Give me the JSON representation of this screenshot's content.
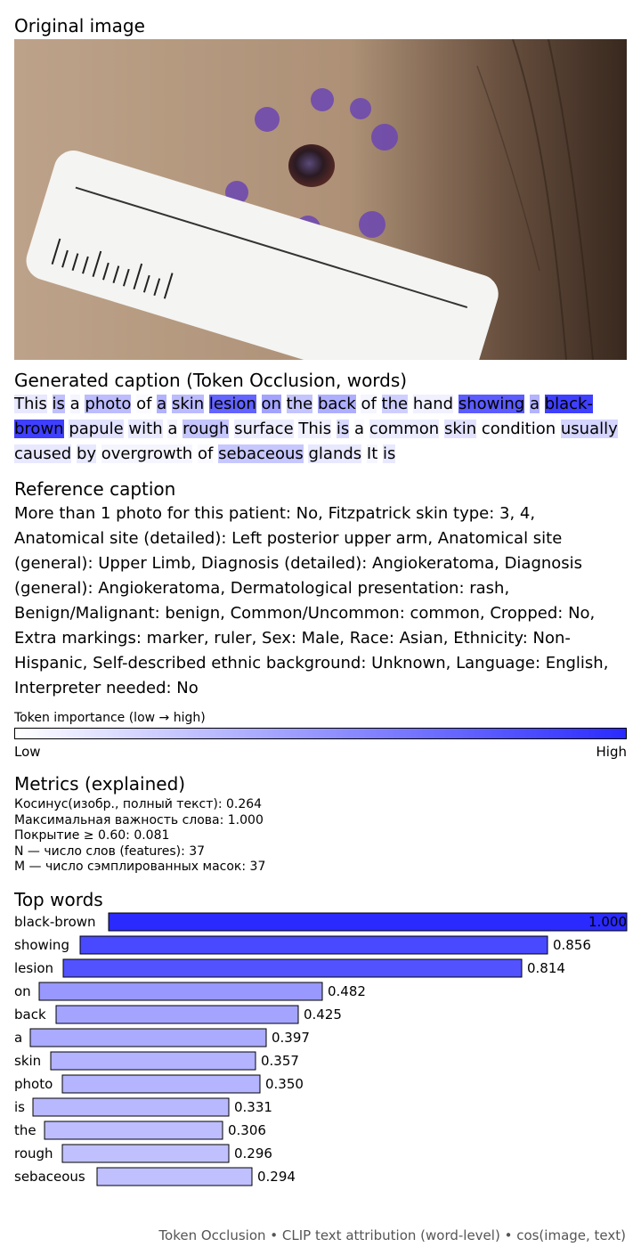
{
  "headings": {
    "original": "Original image",
    "generated": "Generated caption (Token Occlusion, words)",
    "reference": "Reference caption",
    "metrics": "Metrics (explained)",
    "top_words": "Top words"
  },
  "caption_words": [
    {
      "w": "This",
      "s": 0.12
    },
    {
      "w": "is",
      "s": 0.33
    },
    {
      "w": "a",
      "s": 0.05
    },
    {
      "w": "photo",
      "s": 0.35
    },
    {
      "w": "of",
      "s": 0.02
    },
    {
      "w": "a",
      "s": 0.4
    },
    {
      "w": "skin",
      "s": 0.357
    },
    {
      "w": "lesion",
      "s": 0.814
    },
    {
      "w": "on",
      "s": 0.482
    },
    {
      "w": "the",
      "s": 0.306
    },
    {
      "w": "back",
      "s": 0.425
    },
    {
      "w": "of",
      "s": 0.05
    },
    {
      "w": "the",
      "s": 0.25
    },
    {
      "w": "hand",
      "s": 0.08
    },
    {
      "w": "showing",
      "s": 0.856
    },
    {
      "w": "a",
      "s": 0.397
    },
    {
      "w": "black-brown",
      "s": 1.0
    },
    {
      "w": "papule",
      "s": 0.15
    },
    {
      "w": "with",
      "s": 0.12
    },
    {
      "w": "a",
      "s": 0.05
    },
    {
      "w": "rough",
      "s": 0.296
    },
    {
      "w": "surface",
      "s": 0.1
    },
    {
      "w": "This",
      "s": 0.08
    },
    {
      "w": "is",
      "s": 0.2
    },
    {
      "w": "a",
      "s": 0.03
    },
    {
      "w": "common",
      "s": 0.1
    },
    {
      "w": "skin",
      "s": 0.15
    },
    {
      "w": "condition",
      "s": 0.03
    },
    {
      "w": "usually",
      "s": 0.22
    },
    {
      "w": "caused",
      "s": 0.12
    },
    {
      "w": "by",
      "s": 0.12
    },
    {
      "w": "overgrowth",
      "s": 0.05
    },
    {
      "w": "of",
      "s": 0.03
    },
    {
      "w": "sebaceous",
      "s": 0.294
    },
    {
      "w": "glands",
      "s": 0.12
    },
    {
      "w": "It",
      "s": 0.05
    },
    {
      "w": "is",
      "s": 0.12
    }
  ],
  "reference_caption": "More than 1 photo for this patient: No, Fitzpatrick skin type: 3, 4, Anatomical site (detailed): Left posterior upper arm, Anatomical site (general): Upper Limb, Diagnosis (detailed): Angiokeratoma, Diagnosis (general): Angiokeratoma, Dermatological presentation: rash, Benign/Malignant: benign, Common/Uncommon: common, Cropped: No, Extra markings: marker, ruler, Sex: Male, Race: Asian, Ethnicity: Non-Hispanic, Self-described ethnic background: Unknown, Language: English, Interpreter needed: No",
  "colorbar": {
    "label": "Token importance (low → high)",
    "low": "Low",
    "high": "High",
    "color_low": "#ffffff",
    "color_high": "#2a2aff"
  },
  "metrics": [
    "Косинус(изобр., полный текст): 0.264",
    "Максимальная важность слова: 1.000",
    "Покрытие ≥ 0.60: 0.081",
    "N — число слов (features): 37",
    "M — число сэмплированных масок: 37"
  ],
  "chart_data": {
    "type": "bar",
    "orientation": "horizontal",
    "title": "Top words",
    "categories": [
      "black-brown",
      "showing",
      "lesion",
      "on",
      "back",
      "a",
      "skin",
      "photo",
      "is",
      "the",
      "rough",
      "sebaceous"
    ],
    "values": [
      1.0,
      0.856,
      0.814,
      0.482,
      0.425,
      0.397,
      0.357,
      0.35,
      0.331,
      0.306,
      0.296,
      0.294
    ],
    "value_labels": [
      "1.000",
      "0.856",
      "0.814",
      "0.482",
      "0.425",
      "0.397",
      "0.357",
      "0.350",
      "0.331",
      "0.306",
      "0.296",
      "0.294"
    ],
    "bar_start_offsets": [
      0.0,
      0.052,
      0.086,
      0.133,
      0.101,
      0.151,
      0.069,
      0.085,
      0.145,
      0.123,
      0.092,
      0.064
    ],
    "xlim": [
      0,
      1
    ],
    "grid": false,
    "legend": "none"
  },
  "footer": "Token Occlusion • CLIP text attribution (word-level) • cos(image, text)"
}
